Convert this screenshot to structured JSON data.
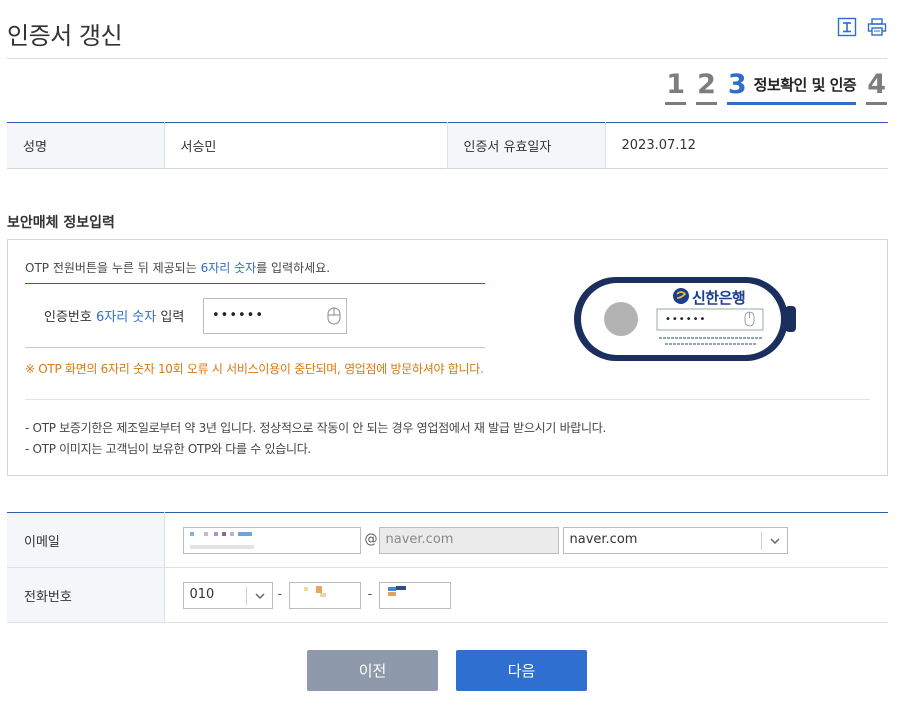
{
  "page": {
    "title": "인증서 갱신",
    "icons": [
      "download-icon",
      "print-icon"
    ]
  },
  "steps": {
    "items": [
      "1",
      "2",
      "3",
      "4"
    ],
    "active_index": 3,
    "active_label": "정보확인 및 인증"
  },
  "info": {
    "name_label": "성명",
    "name_value": "서승민",
    "expiry_label": "인증서 유효일자",
    "expiry_value": "2023.07.12"
  },
  "security": {
    "section_title": "보안매체 정보입력",
    "guide_prefix": "OTP 전원버튼을 누른 뒤 제공되는 ",
    "guide_highlight": "6자리 숫자",
    "guide_suffix": "를 입력하세요.",
    "input_label_prefix": "인증번호 ",
    "input_label_highlight": "6자리 숫자",
    "input_label_suffix": " 입력",
    "input_value": "••••••",
    "warning": "※ OTP 화면의 6자리 숫자 10회 오류 시 서비스이용이 중단되며, 영업점에 방문하셔야 합니다.",
    "device_bank": "신한은행",
    "device_value": "••••••",
    "notes": [
      "-  OTP 보증기한은 제조일로부터 약 3년 입니다. 정상적으로 작동이 안 되는 경우 영업점에서 재 발급 받으시기 바랍니다.",
      "-  OTP 이미지는 고객님이 보유한 OTP와 다를 수 있습니다."
    ]
  },
  "contact": {
    "email_label": "이메일",
    "email_at": "@",
    "email_domain_input": "naver.com",
    "email_domain_select": "naver.com",
    "phone_label": "전화번호",
    "phone_prefix": "010",
    "phone_dash": "-"
  },
  "buttons": {
    "prev": "이전",
    "next": "다음"
  },
  "colors": {
    "accent": "#2e6ec9",
    "warning": "#d47a12",
    "prev_button": "#8e9aab",
    "next_button": "#2e6fcf"
  }
}
